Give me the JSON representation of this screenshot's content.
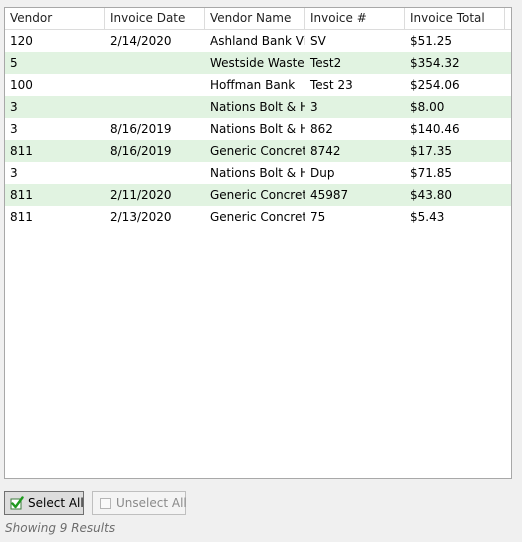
{
  "grid": {
    "columns": [
      "Vendor",
      "Invoice Date",
      "Vendor Name",
      "Invoice #",
      "Invoice Total"
    ],
    "rows": [
      {
        "vendor": "120",
        "invoice_date": "2/14/2020",
        "vendor_name": "Ashland Bank Visa",
        "invoice_no": "SV",
        "invoice_total": "$51.25"
      },
      {
        "vendor": "5",
        "invoice_date": "",
        "vendor_name": "Westside Waste Management",
        "invoice_no": "Test2",
        "invoice_total": "$354.32"
      },
      {
        "vendor": "100",
        "invoice_date": "",
        "vendor_name": "Hoffman Bank",
        "invoice_no": "Test 23",
        "invoice_total": "$254.06"
      },
      {
        "vendor": "3",
        "invoice_date": "",
        "vendor_name": "Nations Bolt & Hardware",
        "invoice_no": "3",
        "invoice_total": "$8.00"
      },
      {
        "vendor": "3",
        "invoice_date": "8/16/2019",
        "vendor_name": "Nations Bolt & Hardware",
        "invoice_no": "862",
        "invoice_total": "$140.46"
      },
      {
        "vendor": "811",
        "invoice_date": "8/16/2019",
        "vendor_name": "Generic Concrete",
        "invoice_no": "8742",
        "invoice_total": "$17.35"
      },
      {
        "vendor": "3",
        "invoice_date": "",
        "vendor_name": "Nations Bolt & Hardware",
        "invoice_no": "Dup",
        "invoice_total": "$71.85"
      },
      {
        "vendor": "811",
        "invoice_date": "2/11/2020",
        "vendor_name": "Generic Concrete",
        "invoice_no": "45987",
        "invoice_total": "$43.80"
      },
      {
        "vendor": "811",
        "invoice_date": "2/13/2020",
        "vendor_name": "Generic Concrete",
        "invoice_no": "75",
        "invoice_total": "$5.43"
      }
    ],
    "alt_row_color": "#e1f3e1"
  },
  "buttons": {
    "select_all": {
      "label": "Select All",
      "icon": "green-checkbox-icon",
      "enabled": true
    },
    "unselect_all": {
      "label": "Unselect All",
      "icon": "empty-checkbox-icon",
      "enabled": false
    }
  },
  "status": {
    "text": "Showing 9 Results"
  }
}
